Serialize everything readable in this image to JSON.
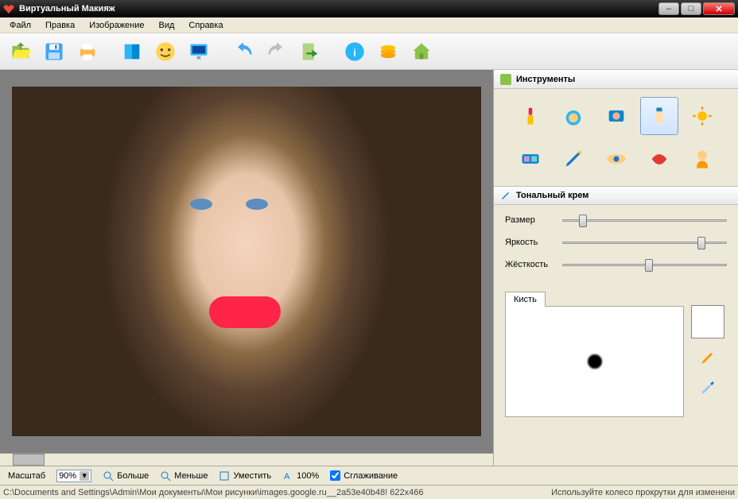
{
  "window": {
    "title": "Виртуальный Макияж"
  },
  "menu": [
    "Файл",
    "Правка",
    "Изображение",
    "Вид",
    "Справка"
  ],
  "toolbar": [
    "open",
    "save",
    "print",
    "sep",
    "book",
    "smiley",
    "monitor",
    "sep",
    "undo",
    "redo",
    "export",
    "sep",
    "info",
    "coins",
    "home"
  ],
  "sidepanel": {
    "tools_header": "Инструменты",
    "tools": [
      {
        "name": "lipstick",
        "selected": false
      },
      {
        "name": "powder",
        "selected": false
      },
      {
        "name": "blush",
        "selected": false
      },
      {
        "name": "foundation",
        "selected": true
      },
      {
        "name": "sun",
        "selected": false
      },
      {
        "name": "eyeshadow",
        "selected": false
      },
      {
        "name": "pencil",
        "selected": false
      },
      {
        "name": "eye",
        "selected": false
      },
      {
        "name": "lips",
        "selected": false
      },
      {
        "name": "model",
        "selected": false
      }
    ],
    "section_header": "Тональный крем",
    "sliders": {
      "size": {
        "label": "Размер",
        "pos": 10
      },
      "brightness": {
        "label": "Яркость",
        "pos": 82
      },
      "hardness": {
        "label": "Жёсткость",
        "pos": 50
      }
    },
    "brush_tab": "Кисть"
  },
  "zoombar": {
    "scale_label": "Масштаб",
    "scale_value": "90%",
    "more": "Больше",
    "less": "Меньше",
    "fit": "Уместить",
    "hundred": "100%",
    "smoothing": "Сглаживание",
    "smoothing_checked": true
  },
  "status": {
    "path": "C:\\Documents and Settings\\Admin\\Мои документы\\Мои рисунки\\images.google.ru__2a53e40b48! 622x466",
    "hint": "Используйте колесо прокрутки для изменени"
  }
}
